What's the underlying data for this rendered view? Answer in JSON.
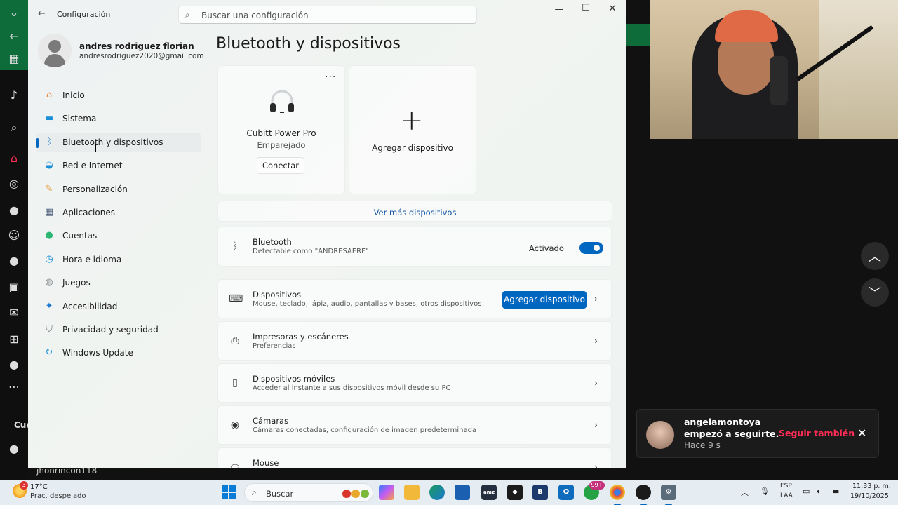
{
  "window": {
    "title": "Configuración",
    "search_placeholder": "Buscar una configuración"
  },
  "user": {
    "name": "andres rodriguez florian",
    "email": "andresrodriguez2020@gmail.com"
  },
  "nav": [
    {
      "label": "Inicio",
      "icon": "home-icon",
      "color": "#e6823c"
    },
    {
      "label": "Sistema",
      "icon": "system-icon",
      "color": "#1a8fd8"
    },
    {
      "label": "Bluetooth y dispositivos",
      "icon": "bluetooth-icon",
      "color": "#1a78d0"
    },
    {
      "label": "Red e Internet",
      "icon": "wifi-icon",
      "color": "#1a8fd8"
    },
    {
      "label": "Personalización",
      "icon": "brush-icon",
      "color": "#e59c3c"
    },
    {
      "label": "Aplicaciones",
      "icon": "apps-icon",
      "color": "#4a5b7a"
    },
    {
      "label": "Cuentas",
      "icon": "account-icon",
      "color": "#2bb673"
    },
    {
      "label": "Hora e idioma",
      "icon": "clock-globe-icon",
      "color": "#1a8fd8"
    },
    {
      "label": "Juegos",
      "icon": "gamepad-icon",
      "color": "#8a8f96"
    },
    {
      "label": "Accesibilidad",
      "icon": "accessibility-icon",
      "color": "#1a78d0"
    },
    {
      "label": "Privacidad y seguridad",
      "icon": "shield-icon",
      "color": "#6f7780"
    },
    {
      "label": "Windows Update",
      "icon": "update-icon",
      "color": "#1a8fd8"
    }
  ],
  "page": {
    "title": "Bluetooth y dispositivos",
    "device_card": {
      "name": "Cubitt Power Pro",
      "status": "Emparejado",
      "button": "Conectar",
      "more": "..."
    },
    "add_card": {
      "label": "Agregar dispositivo",
      "plus": "+"
    },
    "more_devices": "Ver más dispositivos",
    "bluetooth_row": {
      "title": "Bluetooth",
      "subtitle": "Detectable como \"ANDRESAERF\"",
      "toggle_label": "Activado",
      "on": true
    },
    "rows": [
      {
        "title": "Dispositivos",
        "subtitle": "Mouse, teclado, lápiz, audio, pantallas y bases, otros dispositivos",
        "button": "Agregar dispositivo",
        "icon": "devices-icon"
      },
      {
        "title": "Impresoras y escáneres",
        "subtitle": "Preferencias",
        "icon": "printer-icon"
      },
      {
        "title": "Dispositivos móviles",
        "subtitle": "Acceder al instante a sus dispositivos móvil desde su PC",
        "icon": "phone-icon"
      },
      {
        "title": "Cámaras",
        "subtitle": "Cámaras conectadas, configuración de imagen predeterminada",
        "icon": "camera-icon"
      },
      {
        "title": "Mouse",
        "subtitle": "",
        "icon": "mouse-icon"
      }
    ]
  },
  "tiktok": {
    "notification": {
      "user": "angelamontoya",
      "message": "empezó a seguirte.",
      "time": "Hace 9 s",
      "action": "Seguir también"
    },
    "sidebar_label": "Cue",
    "username": "jhonrincon118"
  },
  "taskbar": {
    "weather_temp": "17°C",
    "weather_desc": "Prac. despejado",
    "weather_badge": "3",
    "search_label": "Buscar",
    "badge": "99+",
    "lang1": "ESP",
    "lang2": "LAA",
    "time": "11:33 p. m.",
    "date": "19/10/2025"
  }
}
